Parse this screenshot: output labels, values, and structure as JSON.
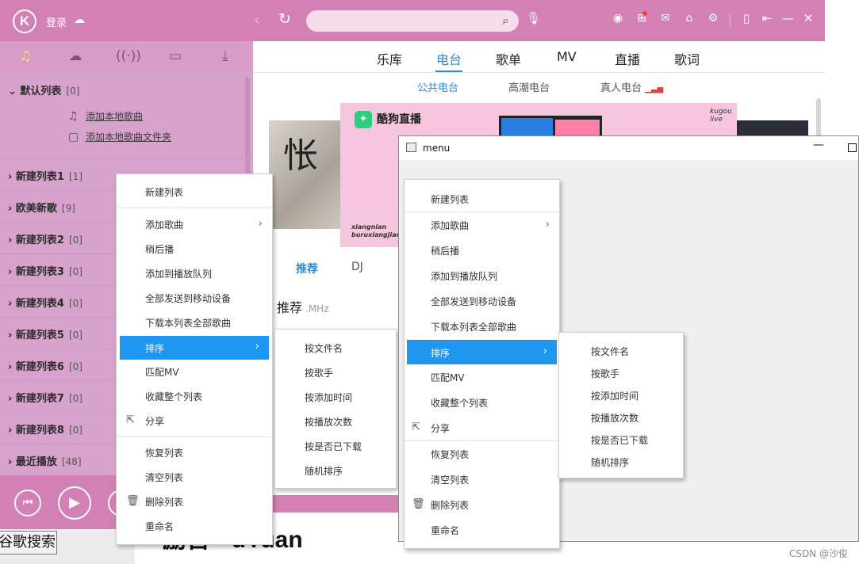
{
  "app": {
    "logo_letter": "K",
    "login_label": "登录",
    "icons": {
      "cloud": "cloud-icon",
      "back": "back-icon",
      "refresh": "refresh-icon",
      "search": "search-icon",
      "mic": "mic-icon",
      "skin": "skin-icon",
      "apps": "apps-icon",
      "mail": "mail-icon",
      "shirt": "shirt-icon",
      "settings": "gear-icon",
      "mini": "mini-mode-icon",
      "exit": "exit-icon",
      "minimize": "minimize-icon",
      "close": "close-icon"
    },
    "accent_color": "#d381b4",
    "highlight_color": "#1e97f0"
  },
  "sidebar": {
    "icon_tabs": [
      "music-icon",
      "cloud-icon",
      "radio-icon",
      "device-icon",
      "download-icon"
    ],
    "default_list": {
      "name": "默认列表",
      "count": "[0]"
    },
    "add_local_song": "添加本地歌曲",
    "add_local_folder": "添加本地歌曲文件夹",
    "playlists": [
      {
        "name": "新建列表1",
        "count": "[1]"
      },
      {
        "name": "欧美新歌",
        "count": "[9]"
      },
      {
        "name": "新建列表2",
        "count": "[0]"
      },
      {
        "name": "新建列表3",
        "count": "[0]"
      },
      {
        "name": "新建列表4",
        "count": "[0]"
      },
      {
        "name": "新建列表5",
        "count": "[0]"
      },
      {
        "name": "新建列表6",
        "count": "[0]"
      },
      {
        "name": "新建列表7",
        "count": "[0]"
      },
      {
        "name": "新建列表8",
        "count": "[0]"
      },
      {
        "name": "最近播放",
        "count": "[48]"
      }
    ]
  },
  "content": {
    "tabs": [
      "乐库",
      "电台",
      "歌单",
      "MV",
      "直播",
      "歌词"
    ],
    "active_tab": "电台",
    "subtabs": [
      "公共电台",
      "高潮电台",
      "真人电台"
    ],
    "banner_brand": "酷狗直播",
    "banner_sub": "xiangnian\nburuxiangjian",
    "banner_kugou": "kugou\nlive",
    "radio_tabs": [
      "推荐",
      "DJ"
    ],
    "section_title": "推荐",
    "section_unit": ".MHz"
  },
  "context_menu": {
    "items": [
      "新建列表",
      "添加歌曲",
      "稍后播",
      "添加到播放队列",
      "全部发送到移动设备",
      "下载本列表全部歌曲",
      "排序",
      "匹配MV",
      "收藏整个列表",
      "分享",
      "恢复列表",
      "清空列表",
      "删除列表",
      "重命名"
    ],
    "highlighted": "排序",
    "submenu_arrow_items": [
      "添加歌曲",
      "排序"
    ]
  },
  "sort_submenu": {
    "items": [
      "按文件名",
      "按歌手",
      "按添加时间",
      "按播放次数",
      "按是否已下载",
      "随机排序"
    ]
  },
  "menu_window": {
    "title": "menu"
  },
  "background": {
    "google_button": "谷歌搜索",
    "partial_title": "励吾 - uYuan",
    "watermark": "CSDN @沙俊"
  }
}
